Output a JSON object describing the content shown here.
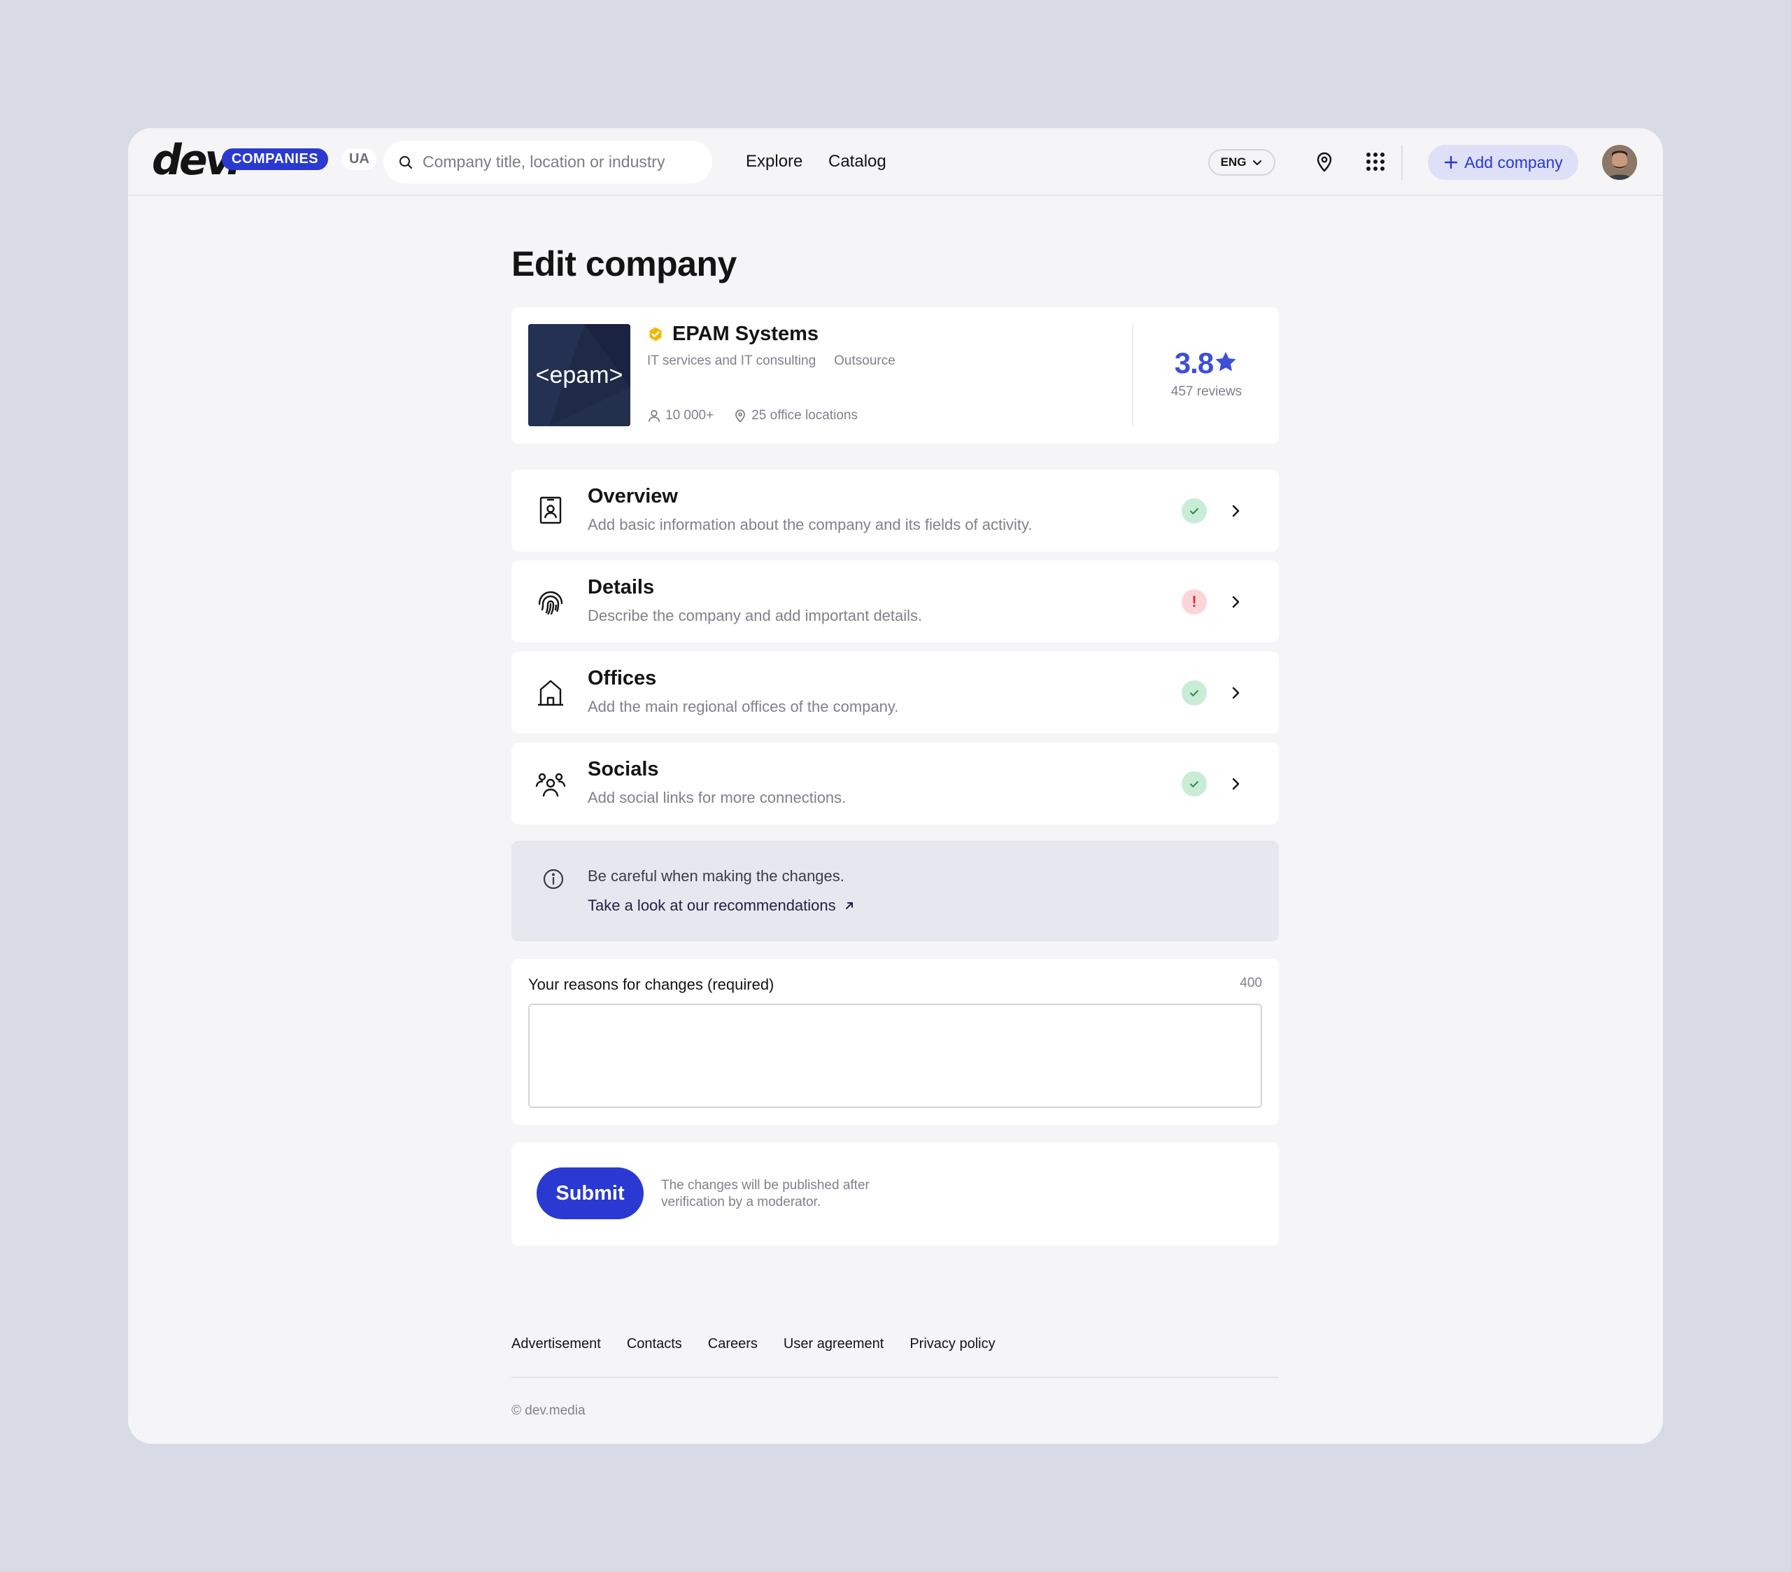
{
  "header": {
    "logo_word": "dev.",
    "logo_badge": "COMPANIES",
    "region": "UA",
    "search_placeholder": "Company title, location or industry",
    "nav": [
      "Explore",
      "Catalog"
    ],
    "language": "ENG",
    "add_company_label": "Add company"
  },
  "page": {
    "title": "Edit company"
  },
  "company": {
    "logo_text": "<epam>",
    "name": "EPAM Systems",
    "tags": [
      "IT services and IT consulting",
      "Outsource"
    ],
    "employees": "10 000+",
    "offices": "25 office locations",
    "rating": "3.8",
    "reviews": "457 reviews"
  },
  "sections": [
    {
      "title": "Overview",
      "description": "Add basic information about the company and its fields of activity.",
      "status": "complete"
    },
    {
      "title": "Details",
      "description": "Describe the company and add important details.",
      "status": "warning"
    },
    {
      "title": "Offices",
      "description": "Add the main regional offices of the company.",
      "status": "complete"
    },
    {
      "title": "Socials",
      "description": "Add social links for more connections.",
      "status": "complete"
    }
  ],
  "notice": {
    "text": "Be careful when making the changes.",
    "link": "Take a look at our recommendations"
  },
  "reasons": {
    "label": "Your reasons for changes (required)",
    "limit": "400",
    "value": ""
  },
  "submit": {
    "label": "Submit",
    "note": "The changes will be published after verification by a moderator."
  },
  "footer": {
    "links": [
      "Advertisement",
      "Contacts",
      "Careers",
      "User agreement",
      "Privacy policy"
    ],
    "copyright": "© dev.media"
  },
  "colors": {
    "accent": "#2a39d1",
    "rating": "#3d4fd6",
    "success_bg": "#c9ecd6",
    "warning_bg": "#fbd5d8",
    "verified": "#f2b705"
  }
}
